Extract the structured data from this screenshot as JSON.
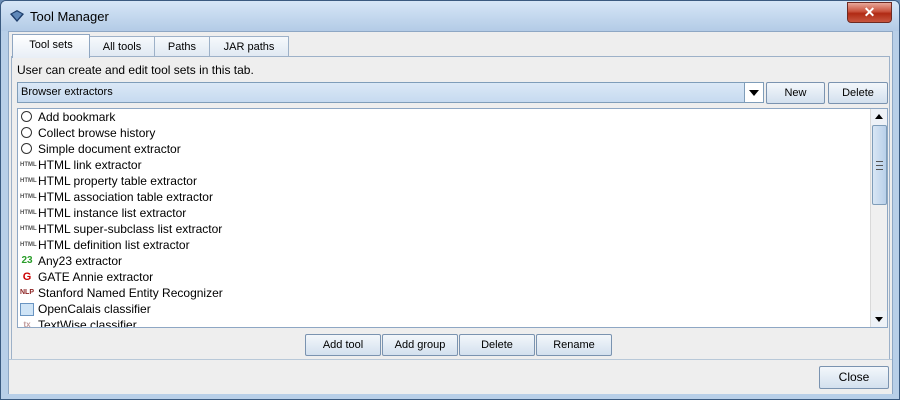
{
  "window": {
    "title": "Tool Manager",
    "close_glyph": "✕"
  },
  "tabs": [
    {
      "label": "Tool sets",
      "active": true
    },
    {
      "label": "All tools",
      "active": false
    },
    {
      "label": "Paths",
      "active": false
    },
    {
      "label": "JAR paths",
      "active": false
    }
  ],
  "panel": {
    "description": "User can create and edit tool sets in this tab.",
    "toolset_select": {
      "value": "Browser extractors"
    },
    "new_label": "New",
    "delete_label": "Delete"
  },
  "tools": [
    {
      "label": "Add bookmark",
      "icon": "reload-icon",
      "glyph": ""
    },
    {
      "label": "Collect browse history",
      "icon": "reload-icon",
      "glyph": ""
    },
    {
      "label": "Simple document extractor",
      "icon": "reload-icon",
      "glyph": ""
    },
    {
      "label": "HTML link extractor",
      "icon": "html-icon",
      "glyph": "HTML"
    },
    {
      "label": "HTML property table extractor",
      "icon": "html-icon",
      "glyph": "HTML"
    },
    {
      "label": "HTML association table extractor",
      "icon": "html-icon",
      "glyph": "HTML"
    },
    {
      "label": "HTML instance list extractor",
      "icon": "html-icon",
      "glyph": "HTML"
    },
    {
      "label": "HTML super-subclass list extractor",
      "icon": "html-icon",
      "glyph": "HTML"
    },
    {
      "label": "HTML definition list extractor",
      "icon": "html-icon",
      "glyph": "HTML"
    },
    {
      "label": "Any23 extractor",
      "icon": "any23-icon",
      "glyph": "23"
    },
    {
      "label": "GATE Annie extractor",
      "icon": "gate-icon",
      "glyph": "G"
    },
    {
      "label": "Stanford Named Entity Recognizer",
      "icon": "nlp-icon",
      "glyph": "NLP"
    },
    {
      "label": "OpenCalais classifier",
      "icon": "opencalais-icon",
      "glyph": ""
    },
    {
      "label": "TextWise classifier",
      "icon": "textwise-icon",
      "glyph": "tx"
    }
  ],
  "tool_buttons": {
    "add_tool": "Add tool",
    "add_group": "Add group",
    "delete": "Delete",
    "rename": "Rename"
  },
  "footer": {
    "close_label": "Close"
  },
  "colors": {
    "title_bar": "#b3cbe6",
    "selection_combo": "#c6daf0",
    "close_button": "#c9513b"
  }
}
